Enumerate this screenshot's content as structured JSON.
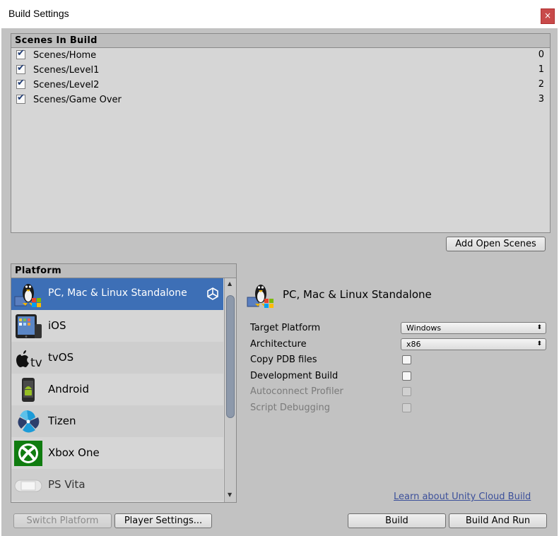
{
  "window": {
    "title": "Build Settings",
    "close_glyph": "×"
  },
  "scenes_panel": {
    "header": "Scenes In Build",
    "scenes": [
      {
        "name": "Scenes/Home",
        "index": "0",
        "checked": true
      },
      {
        "name": "Scenes/Level1",
        "index": "1",
        "checked": true
      },
      {
        "name": "Scenes/Level2",
        "index": "2",
        "checked": true
      },
      {
        "name": "Scenes/Game Over",
        "index": "3",
        "checked": true
      }
    ],
    "add_open_scenes_label": "Add Open Scenes"
  },
  "platform_panel": {
    "header": "Platform",
    "items": [
      {
        "label": "PC, Mac & Linux Standalone",
        "icon": "linux-tux-icon",
        "selected": true
      },
      {
        "label": "iOS",
        "icon": "ipad-icon"
      },
      {
        "label": "tvOS",
        "icon": "apple-tv-icon"
      },
      {
        "label": "Android",
        "icon": "android-phone-icon"
      },
      {
        "label": "Tizen",
        "icon": "tizen-icon"
      },
      {
        "label": "Xbox One",
        "icon": "xbox-icon"
      },
      {
        "label": "PS Vita",
        "icon": "ps-vita-icon"
      }
    ]
  },
  "details": {
    "platform_title": "PC, Mac & Linux Standalone",
    "target_platform_label": "Target Platform",
    "target_platform_value": "Windows",
    "architecture_label": "Architecture",
    "architecture_value": "x86",
    "copy_pdb_label": "Copy PDB files",
    "development_build_label": "Development Build",
    "autoconnect_profiler_label": "Autoconnect Profiler",
    "script_debugging_label": "Script Debugging",
    "cloud_build_link": "Learn about Unity Cloud Build"
  },
  "footer": {
    "switch_platform_label": "Switch Platform",
    "player_settings_label": "Player Settings...",
    "build_label": "Build",
    "build_and_run_label": "Build And Run"
  },
  "colors": {
    "selection": "#3d6fb6",
    "client_bg": "#c2c2c2",
    "panel_bg": "#d6d6d6",
    "link": "#3b4f9a"
  }
}
